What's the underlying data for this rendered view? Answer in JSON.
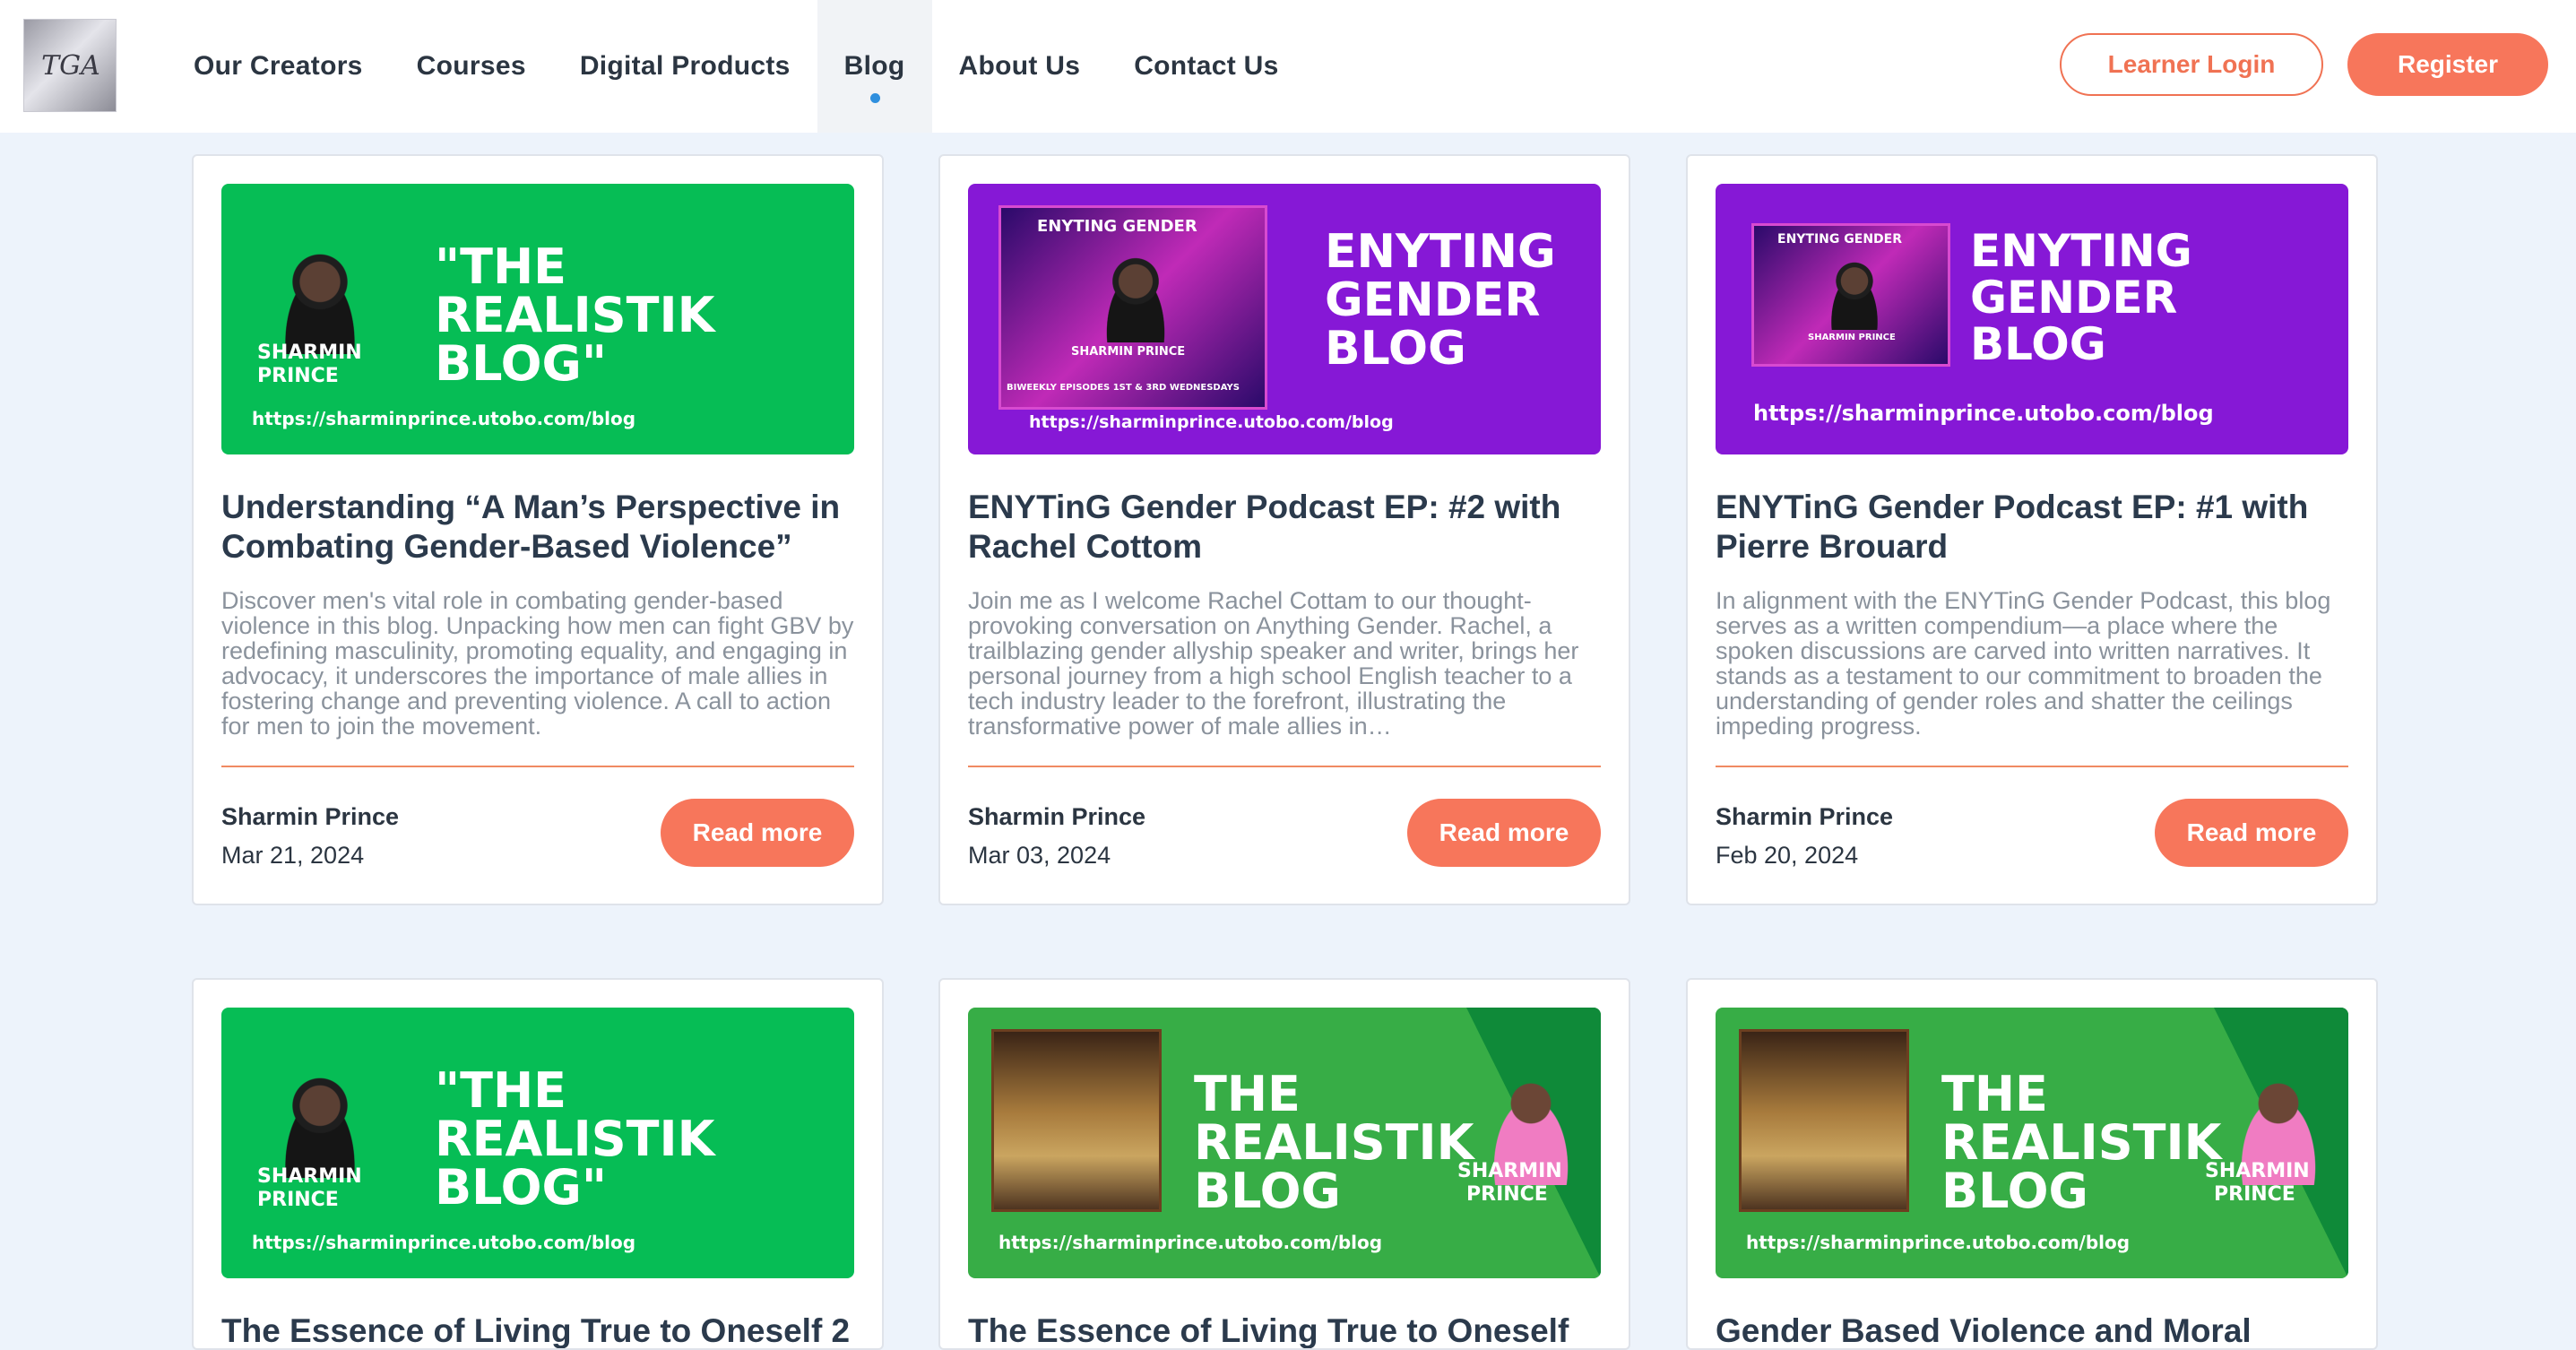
{
  "header": {
    "logo_text": "TGA",
    "nav": [
      {
        "label": "Our Creators"
      },
      {
        "label": "Courses"
      },
      {
        "label": "Digital Products"
      },
      {
        "label": "Blog"
      },
      {
        "label": "About Us"
      },
      {
        "label": "Contact Us"
      }
    ],
    "active_nav": "Blog",
    "login_label": "Learner Login",
    "register_label": "Register"
  },
  "read_more_label": "Read more",
  "posts": [
    {
      "title": "Understanding “A Man’s Perspective in Combating Gender-Based Violence”",
      "excerpt": "Discover men's vital role in combating gender-based violence in this blog. Unpacking how men can fight GBV by redefining masculinity, promoting equality, and engaging in advocacy, it underscores the importance of male allies in fostering change and preventing violence. A call to action for men to join the movement.",
      "author": "Sharmin Prince",
      "date": "Mar 21, 2024",
      "image": {
        "headline_1": "\"THE",
        "headline_2": "REALISTIK",
        "headline_3": "BLOG\"",
        "name_1": "SHARMIN",
        "name_2": "PRINCE",
        "url": "https://sharminprince.utobo.com/blog"
      }
    },
    {
      "title": "ENYTinG Gender Podcast EP: #2 with Rachel Cottom",
      "excerpt": "Join me as I welcome Rachel Cottam to our thought-provoking conversation on Anything Gender. Rachel, a trailblazing gender allyship speaker and writer, brings her personal journey from a high school English teacher to a tech industry leader to the forefront, illustrating the transformative power of male allies in…",
      "author": "Sharmin Prince",
      "date": "Mar 03, 2024",
      "image": {
        "headline_1": "ENYTING",
        "headline_2": "GENDER",
        "headline_3": "BLOG",
        "poster_title": "ENYTING GENDER",
        "poster_sub": "SHARMIN PRINCE",
        "poster_note": "BIWEEKLY EPISODES 1ST & 3RD WEDNESDAYS",
        "url": "https://sharminprince.utobo.com/blog"
      }
    },
    {
      "title": "ENYTinG Gender Podcast EP: #1 with Pierre Brouard",
      "excerpt": "In alignment with the ENYTinG Gender Podcast, this blog serves as a written compendium—a place where the spoken discussions are carved into written narratives. It stands as a testament to our commitment to broaden the understanding of gender roles and shatter the ceilings impeding progress.",
      "author": "Sharmin Prince",
      "date": "Feb 20, 2024",
      "image": {
        "headline_1": "ENYTING",
        "headline_2": "GENDER",
        "headline_3": "BLOG",
        "poster_title": "ENYTING GENDER",
        "poster_sub": "SHARMIN PRINCE",
        "url": "https://sharminprince.utobo.com/blog"
      }
    },
    {
      "title": "The Essence of Living True to Oneself 2",
      "image": {
        "headline_1": "\"THE",
        "headline_2": "REALISTIK",
        "headline_3": "BLOG\"",
        "name_1": "SHARMIN",
        "name_2": "PRINCE",
        "url": "https://sharminprince.utobo.com/blog"
      }
    },
    {
      "title": "The Essence of Living True to Oneself",
      "image": {
        "headline_1": "THE",
        "headline_2": "REALISTIK",
        "headline_3": "BLOG",
        "name_1": "SHARMIN",
        "name_2": "PRINCE",
        "url": "https://sharminprince.utobo.com/blog"
      }
    },
    {
      "title": "Gender Based Violence and Moral",
      "image": {
        "headline_1": "THE",
        "headline_2": "REALISTIK",
        "headline_3": "BLOG",
        "name_1": "SHARMIN",
        "name_2": "PRINCE",
        "url": "https://sharminprince.utobo.com/blog"
      }
    }
  ],
  "colors": {
    "accent": "#f7765b",
    "active_dot": "#2f8fde",
    "title_text": "#2b3a4c",
    "excerpt_text": "#8a929c",
    "page_bg": "#edf3fb"
  }
}
